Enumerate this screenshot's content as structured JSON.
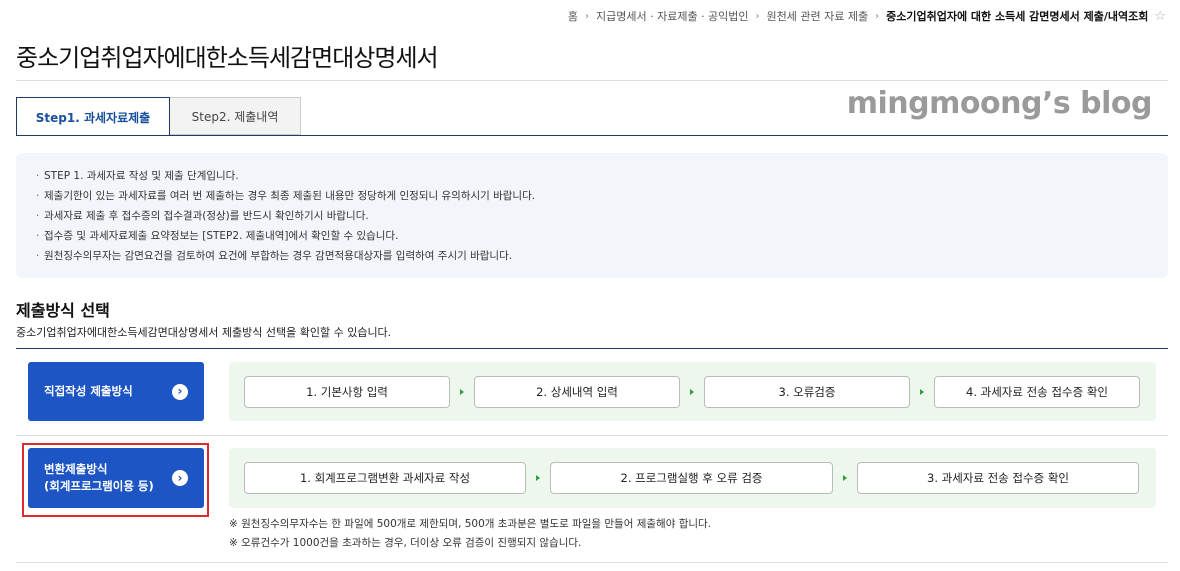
{
  "breadcrumb": {
    "items": [
      "홈",
      "지급명세서 · 자료제출 · 공익법인",
      "원천세 관련 자료 제출",
      "중소기업취업자에 대한 소득세 감면명세서 제출/내역조회"
    ],
    "separator": "›",
    "star": "☆"
  },
  "page_title": "중소기업취업자에대한소득세감면대상명세서",
  "tabs": [
    {
      "label": "Step1. 과세자료제출",
      "active": true
    },
    {
      "label": "Step2. 제출내역",
      "active": false
    }
  ],
  "watermark": "mingmoong’s blog",
  "notice": [
    "STEP 1. 과세자료 작성 및 제출 단계입니다.",
    "제출기한이 있는 과세자료를 여러 번 제출하는 경우 최종 제출된 내용만 정당하게 인정되니 유의하시기 바랍니다.",
    "과세자료 제출 후 접수증의 접수결과(정상)를 반드시 확인하기시 바랍니다.",
    "접수증 및 과세자료제출 요약정보는 [STEP2. 제출내역]에서 확인할 수 있습니다.",
    "원천징수의무자는 감면요건을 검토하여 요건에 부합하는 경우 감면적용대상자를 입력하여 주시기 바랍니다."
  ],
  "section": {
    "title": "제출방식 선택",
    "description": "중소기업취업자에대한소득세감면대상명세서 제출방식 선택을 확인할 수 있습니다."
  },
  "methods": [
    {
      "label_line1": "직접작성 제출방식",
      "label_line2": "",
      "arrow_icon": "›",
      "steps": [
        "1. 기본사항 입력",
        "2. 상세내역 입력",
        "3. 오류검증",
        "4. 과세자료 전송 접수증 확인"
      ]
    },
    {
      "label_line1": "변환제출방식",
      "label_line2": "(회계프로그램이용 등)",
      "arrow_icon": "›",
      "steps": [
        "1. 회계프로그램변환 과세자료 작성",
        "2. 프로그램실행 후 오류 검증",
        "3. 과세자료 전송 접수증 확인"
      ]
    }
  ],
  "notes": [
    "※ 원천징수의무자수는 한 파일에 500개로 제한되며, 500개 초과분은 별도로 파일을 만들어 제출해야 합니다.",
    "※ 오류건수가 1000건을 초과하는 경우, 더이상 오류 검증이 진행되지 않습니다."
  ],
  "colors": {
    "primary_button": "#1d55c4",
    "active_tab_text": "#1a4fa0",
    "step_box_bg": "#eef7ee",
    "step_arrow": "#2e9e3e",
    "highlight_border": "#e0292b",
    "notice_bg": "#f2f5f9"
  }
}
